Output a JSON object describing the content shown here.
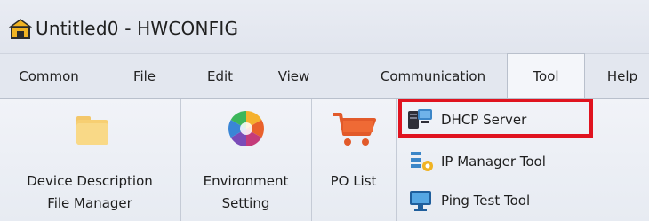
{
  "window": {
    "title": "Untitled0 - HWCONFIG"
  },
  "menu": {
    "tabs": [
      {
        "label": "Common"
      },
      {
        "label": "File"
      },
      {
        "label": "Edit"
      },
      {
        "label": "View"
      },
      {
        "label": "Communication"
      },
      {
        "label": "Tool"
      },
      {
        "label": "Help"
      }
    ],
    "active_tab": "Tool"
  },
  "ribbon": {
    "device_description": {
      "line1": "Device Description",
      "line2": "File Manager",
      "icon": "folder-icon"
    },
    "environment_setting": {
      "line1": "Environment",
      "line2": "Setting",
      "icon": "color-wheel-icon"
    },
    "po_list": {
      "label": "PO List",
      "icon": "shopping-cart-icon"
    },
    "dhcp_server": {
      "label": "DHCP Server",
      "icon": "server-icon"
    },
    "ip_manager": {
      "label": "IP Manager Tool",
      "icon": "network-icon"
    },
    "ping_test": {
      "label": "Ping Test Tool",
      "icon": "monitor-icon"
    }
  },
  "colors": {
    "highlight": "#e0131f",
    "ribbon_bg": "#eef1f7"
  }
}
